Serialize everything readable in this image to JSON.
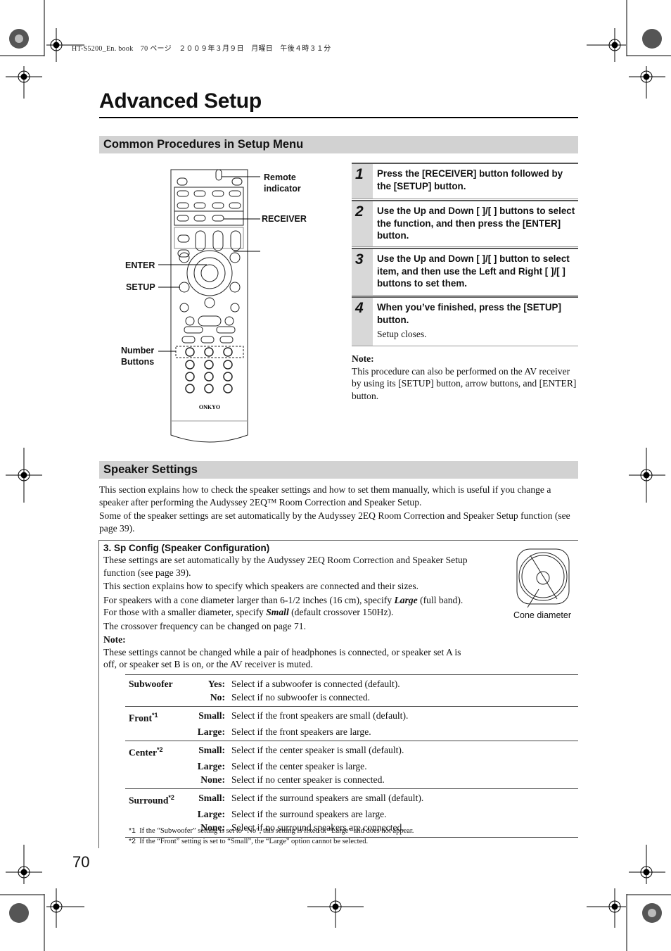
{
  "print_header": "HT-S5200_En. book　70 ページ　２００９年３月９日　月曜日　午後４時３１分",
  "page_title": "Advanced Setup",
  "section1": {
    "heading": "Common Procedures in Setup Menu",
    "remote_labels": {
      "remote_indicator": "Remote indicator",
      "receiver": "RECEIVER",
      "enter": "ENTER",
      "setup": "SETUP",
      "number_buttons": "Number Buttons"
    },
    "remote_brand": "ONKYO",
    "steps": [
      {
        "num": "1",
        "text": "Press the [RECEIVER] button followed by the [SETUP] button.",
        "sub": ""
      },
      {
        "num": "2",
        "text": "Use the Up and Down [   ]/[   ] buttons to select the function, and then press the [ENTER] button.",
        "sub": ""
      },
      {
        "num": "3",
        "text": "Use the Up and Down [   ]/[   ] button to select item, and then use the Left and Right [   ]/[   ] buttons to set them.",
        "sub": ""
      },
      {
        "num": "4",
        "text": "When you’ve finished, press the [SETUP] button.",
        "sub": "Setup closes."
      }
    ],
    "note_label": "Note:",
    "note_text": "This procedure can also be performed on the AV receiver by using its [SETUP] button, arrow buttons, and [ENTER] button."
  },
  "section2": {
    "heading": "Speaker Settings",
    "intro1": "This section explains how to check the speaker settings and how to set them manually, which is useful if you change a speaker after performing the Audyssey 2EQ™ Room Correction and Speaker Setup.",
    "intro2": "Some of the speaker settings are set automatically by the Audyssey 2EQ Room Correction and Speaker Setup function (see page 39).",
    "box": {
      "heading": "3. Sp Config (Speaker Configuration)",
      "p1": "These settings are set automatically by the Audyssey 2EQ Room Correction and Speaker Setup function (see page 39).",
      "p2": "This section explains how to specify which speakers are connected and their sizes.",
      "p3a": "For speakers with a cone diameter larger than 6-1/2 inches (16 cm), specify ",
      "p3b": "Large",
      "p3c": " (full band). For those with a smaller diameter, specify ",
      "p3d": "Small",
      "p3e": " (default crossover 150Hz).",
      "p4": "The crossover frequency can be changed on page 71.",
      "note_label": "Note:",
      "note_text": "These settings cannot be changed while a pair of headphones is connected, or speaker set A is off, or speaker set B is on, or the AV receiver is muted.",
      "figure_caption": "Cone diameter"
    },
    "settings": [
      {
        "name": "Subwoofer",
        "sup": "",
        "options": [
          {
            "key": "Yes:",
            "desc": "Select if a subwoofer is connected (default)."
          },
          {
            "key": "No:",
            "desc": "Select if no subwoofer is connected."
          }
        ]
      },
      {
        "name": "Front",
        "sup": "*1",
        "options": [
          {
            "key": "Small:",
            "desc": "Select if the front speakers are small (default)."
          },
          {
            "key": "Large:",
            "desc": "Select if the front speakers are large."
          }
        ]
      },
      {
        "name": "Center",
        "sup": "*2",
        "options": [
          {
            "key": "Small:",
            "desc": "Select if the center speaker is small (default)."
          },
          {
            "key": "Large:",
            "desc": "Select if the center speaker is large."
          },
          {
            "key": "None:",
            "desc": "Select if no center speaker is connected."
          }
        ]
      },
      {
        "name": "Surround",
        "sup": "*2",
        "options": [
          {
            "key": "Small:",
            "desc": "Select if the surround speakers are small (default)."
          },
          {
            "key": "Large:",
            "desc": "Select if the surround speakers are large."
          },
          {
            "key": "None:",
            "desc": "Select if no surround speakers are connected."
          }
        ]
      }
    ],
    "footnotes": [
      {
        "mark": "*1",
        "text": "If the “Subwoofer” setting is set to “No”, this setting is fixed at “Large” and does not appear."
      },
      {
        "mark": "*2",
        "text": "If the “Front” setting is set to “Small”, the “Large” option cannot be selected."
      }
    ]
  },
  "page_number": "70"
}
